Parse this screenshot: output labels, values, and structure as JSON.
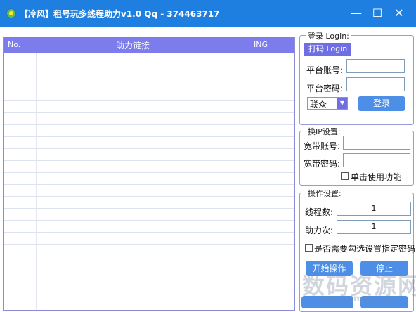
{
  "window": {
    "title": "【冷风】租号玩多线程助力v1.0   Qq - 374463717",
    "minimize_glyph": "—",
    "maximize_glyph": "☐",
    "close_glyph": "✕"
  },
  "list": {
    "columns": [
      "No.",
      "助力链接",
      "ING"
    ]
  },
  "login": {
    "legend": "登录 Login:",
    "tab_label": "打码 Login",
    "account_label": "平台账号:",
    "account_value": "",
    "password_label": "平台密码:",
    "password_value": "",
    "platform_selected": "联众",
    "login_button": "登录"
  },
  "ip": {
    "legend": "换IP设置:",
    "account_label": "宽带账号:",
    "account_value": "",
    "password_label": "宽带密码:",
    "password_value": "",
    "single_click_label": "单击使用功能"
  },
  "ops": {
    "legend": "操作设置:",
    "threads_label": "线程数:",
    "threads_value": "1",
    "times_label": "助力次:",
    "times_value": "1",
    "password_check_label": "是否需要勾选设置指定密码",
    "start_button": "开始操作",
    "stop_button": "停止"
  },
  "colors": {
    "titlebar": "#1e7fe0",
    "list_header": "#7c7cec",
    "button": "#4d8fe6",
    "group_border": "#9a9ad6"
  }
}
